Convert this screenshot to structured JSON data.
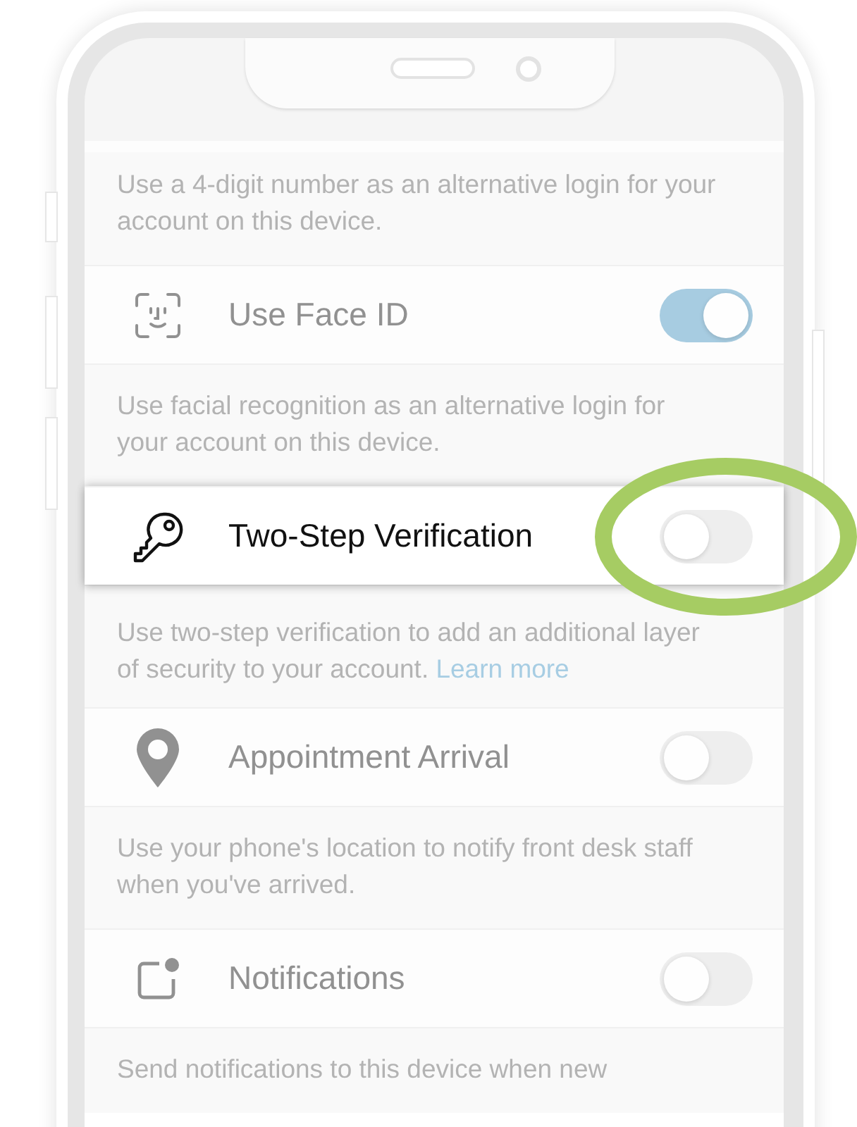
{
  "settings": [
    {
      "description": "Use a 4-digit number as an alternative login for your account on this device."
    },
    {
      "label": "Use Face ID",
      "kind": "face",
      "on": true,
      "highlighted": false,
      "description": "Use facial recognition as an alternative login for your account on this device."
    },
    {
      "label": "Two-Step Verification",
      "kind": "key",
      "on": false,
      "highlighted": true,
      "description": "Use two-step verification to add an additional layer of security to your account.",
      "link": "Learn more"
    },
    {
      "label": "Appointment Arrival",
      "kind": "pin",
      "on": false,
      "highlighted": false,
      "description": "Use your phone's location to notify front desk staff when you've arrived."
    },
    {
      "label": "Notifications",
      "kind": "badge",
      "on": false,
      "highlighted": false,
      "description": "Send notifications to this device when new"
    }
  ]
}
